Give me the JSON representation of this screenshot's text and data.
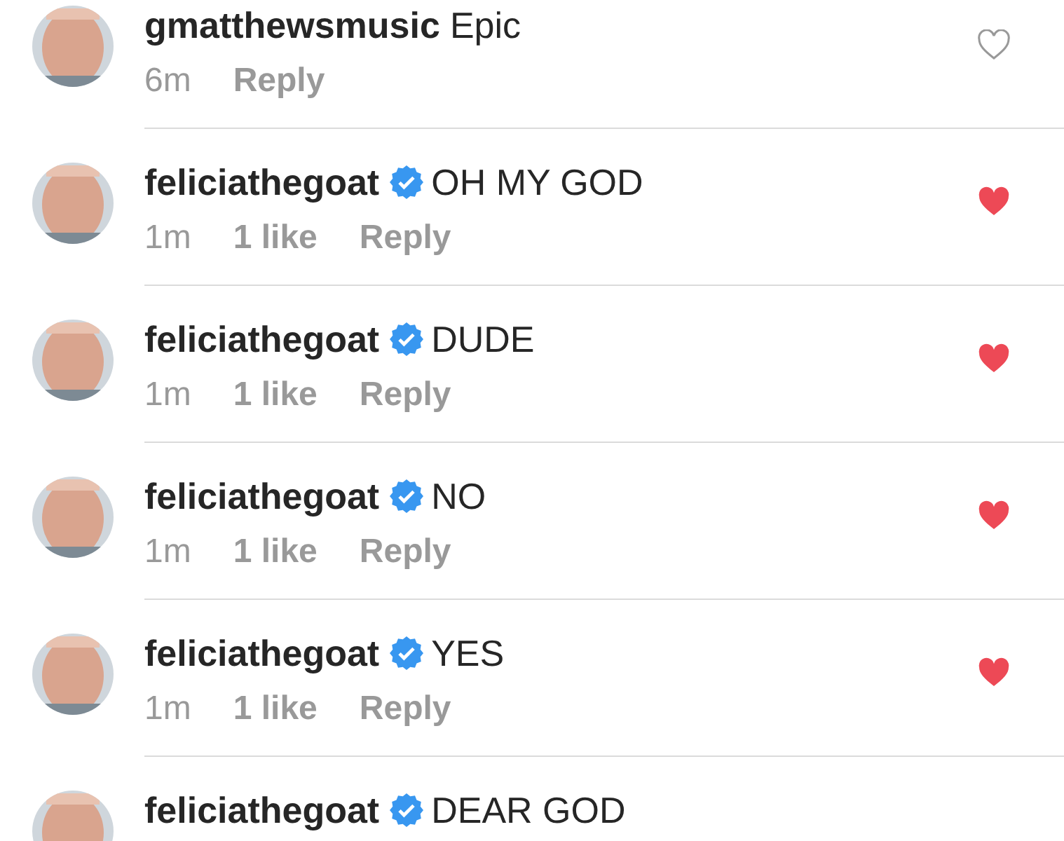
{
  "comments": [
    {
      "username": "gmatthewsmusic",
      "verified": false,
      "text": "Epic",
      "time": "6m",
      "reply": "Reply",
      "liked": false
    },
    {
      "username": "feliciathegoat",
      "verified": true,
      "text": "OH MY GOD",
      "time": "1m",
      "likes": "1 like",
      "reply": "Reply",
      "liked": true
    },
    {
      "username": "feliciathegoat",
      "verified": true,
      "text": "DUDE",
      "time": "1m",
      "likes": "1 like",
      "reply": "Reply",
      "liked": true
    },
    {
      "username": "feliciathegoat",
      "verified": true,
      "text": "NO",
      "time": "1m",
      "likes": "1 like",
      "reply": "Reply",
      "liked": true
    },
    {
      "username": "feliciathegoat",
      "verified": true,
      "text": "YES",
      "time": "1m",
      "likes": "1 like",
      "reply": "Reply",
      "liked": true
    },
    {
      "username": "feliciathegoat",
      "verified": true,
      "text": "DEAR GOD"
    }
  ]
}
